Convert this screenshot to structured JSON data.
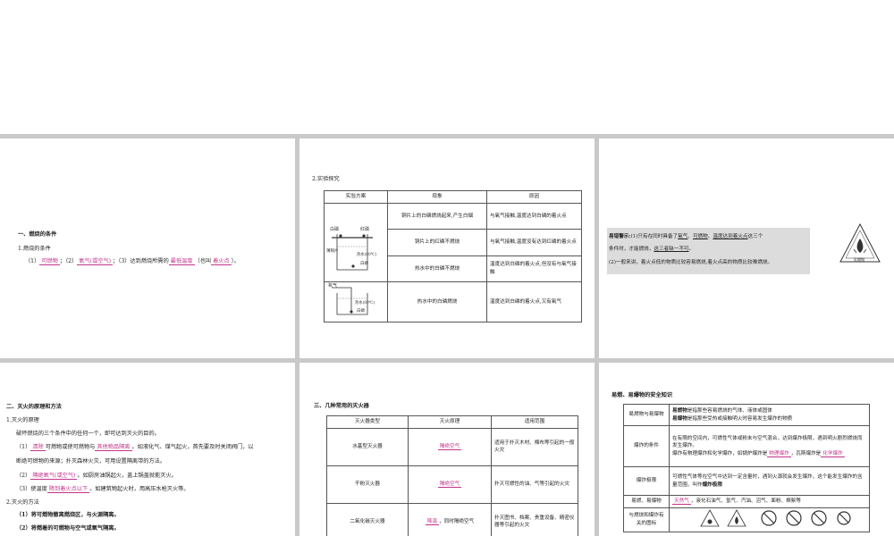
{
  "s1": {
    "h": "一、燃烧的条件",
    "sub": "1.燃烧的条件",
    "p1": "（1）",
    "a1": "可燃物",
    "p2": "；（2）",
    "a2": "氧气(或空气)",
    "p3": "；（3）达到燃烧所需的",
    "a3": "最低温度",
    "p4": "（也叫",
    "a4": "着火点",
    "p5": "）。"
  },
  "s2": {
    "title": "2.实验探究",
    "headers": [
      "实验方案",
      "现象",
      "原因"
    ],
    "rows": [
      {
        "phen": "铜片上的白磷燃烧起来,产生白烟",
        "reason": "与氧气接触,温度达到白磷的着火点"
      },
      {
        "phen": "铜片上的红磷不燃烧",
        "reason": "与氧气接触,温度没有达到红磷的着火点"
      },
      {
        "phen": "热水中的白磷不燃烧",
        "reason": "温度达到白磷的着火点,但没有与氧气接触"
      },
      {
        "phen": "热水中的白磷燃烧",
        "reason": "温度达到白磷的着火点,又有氧气"
      }
    ],
    "fig1": {
      "l1": "白磷",
      "l2": "红磷",
      "l3": "薄铜片",
      "l4": "热水(80℃)",
      "l5": "白磷"
    },
    "fig2": {
      "l1": "氧气",
      "l2": "热水(80℃)",
      "l3": "白磷"
    }
  },
  "s3": {
    "label": "易错警示:",
    "l1a": "(1)只有在同时具备了",
    "k1": "氧气",
    "l1b": "、",
    "k2": "可燃物",
    "l1c": "、",
    "k3": "温度达到着火点",
    "l1d": "这三个",
    "l2a": "条件时，才能燃烧，",
    "k4": "这三者缺一不可",
    "l2b": "。",
    "l3": "(2)一般来讲，着火点低的物质比较容易燃烧,着火点高的物质比较难燃烧。",
    "logo": "可燃物"
  },
  "s4": {
    "h": "二、灭火的原理和方法",
    "sub1": "1.灭火的原理",
    "line1": "破坏燃烧的三个条件中的任何一个，即可达到灭火的目的。",
    "l1a": "（1）",
    "a1": "清除",
    "l1b": "可燃物或使可燃物与",
    "a2": "其他物品隔离",
    "l1c": "。如液化气、煤气起火，首先要及时关闭阀门，以",
    "l1d": "断绝可燃物的来源；扑灭森林火灾，可用设置隔离带的方法。",
    "l2a": "（2）",
    "a3": "隔绝氧气(或空气)",
    "l2b": "。如厨房油锅起火，盖上锅盖就能灭火。",
    "l3a": "（3）使温度",
    "a4": "降到着火点以下",
    "l3b": "。如建筑物起火时，用高压水枪灭火等。",
    "sub2": "2.灭火的方法",
    "m1": "（1）将可燃物撤离燃烧区，与火源隔离。",
    "m2": "（2）将燃着的可燃物与空气或氧气隔离。"
  },
  "s5": {
    "h": "三、几种常用的灭火器",
    "headers": [
      "灭火器类型",
      "灭火原理",
      "适用范围"
    ],
    "rows": [
      {
        "type": "水基型灭火器",
        "principle": "隔绝空气",
        "pextra": "",
        "scope": "适用于扑灭木材、棉布等引起的一般火灾"
      },
      {
        "type": "干粉灭火器",
        "principle": "隔绝空气",
        "pextra": "",
        "scope": "扑灭可燃性的油、气等引起的火灾"
      },
      {
        "type": "二氧化碳灭火器",
        "principle": "降温",
        "pextra": "，同时隔绝空气",
        "scope": "扑灭图书、档案、贵重设备、精密仪器等引起的火灾"
      }
    ]
  },
  "s6": {
    "title": "易燃、易爆物的安全知识",
    "r1label": "易燃物与易爆物",
    "r1a_b": "易燃物",
    "r1a": "是指那些容易燃烧的气体、液体或固体",
    "r1b_b": "易爆物",
    "r1b": "是指那些受热或接触明火时容易发生爆炸的物质",
    "r2label": "爆炸的条件",
    "r2a": "在有限的空间内，可燃性气体或粉末与空气混合，达到爆炸极限，遇到明火剧烈燃烧而发生爆炸。",
    "r2b1": "爆炸有物理爆炸和化学爆炸，如锅炉爆炸是",
    "r2k1": "物理爆炸",
    "r2b2": "，瓦斯爆炸是",
    "r2k2": "化学爆炸",
    "r3label": "爆炸极限",
    "r3a": "可燃性气体等在空气中达到一定含量时，遇到火源就会发生爆炸，这个能发生爆炸的含量范围，叫作",
    "r3b": "爆炸极限",
    "r4label": "易燃、易爆物",
    "r4k": "天然气",
    "r4a": "，液化石油气、氢气、汽油、沼气、面粉、棉絮等",
    "r5label": "与燃烧和爆炸有关的图标"
  }
}
